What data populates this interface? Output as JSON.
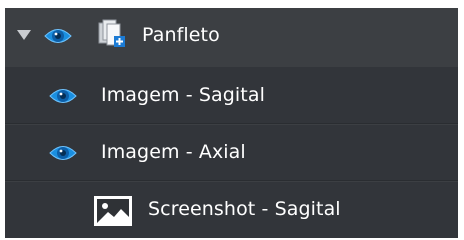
{
  "tree": {
    "rows": [
      {
        "label": "Panfleto",
        "icon": "eye-icon",
        "type_icon": "document-add-icon",
        "expanded": true
      },
      {
        "label": "Imagem - Sagital",
        "icon": "eye-icon"
      },
      {
        "label": "Imagem - Axial",
        "icon": "eye-icon"
      },
      {
        "label": "Screenshot - Sagital",
        "icon": "image-icon"
      }
    ]
  },
  "colors": {
    "background": "#3c3f43",
    "row_background": "#32353a",
    "eye_blue": "#1a8fe0",
    "text": "#ffffff"
  }
}
